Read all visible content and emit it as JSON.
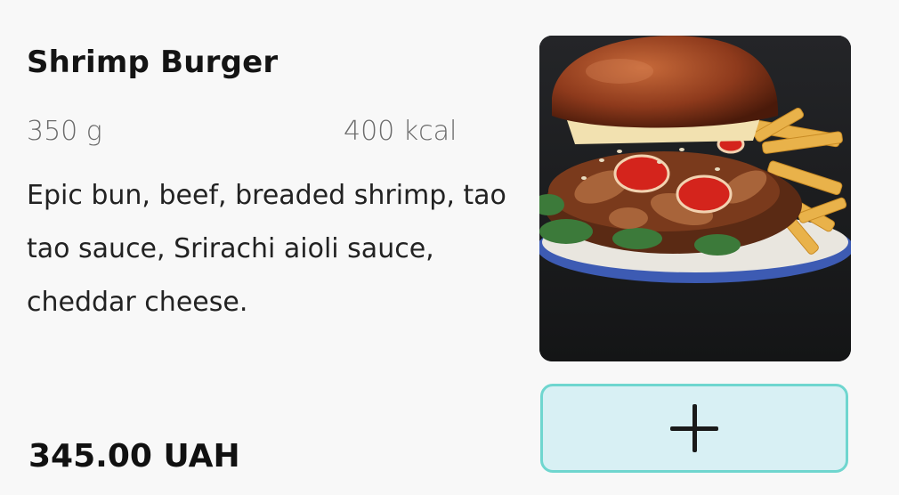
{
  "product": {
    "name": "Shrimp Burger",
    "weight": "350 g",
    "calories": "400 kcal",
    "description": "Epic bun, beef, breaded shrimp, tao tao sauce, Srirachi aioli sauce, cheddar cheese.",
    "price": "345.00 UAH"
  },
  "image": {
    "icon": "burger-photo",
    "background_color": "#1b1c1e",
    "plate_rim_color": "#3d5bb3"
  },
  "add_button": {
    "icon": "plus-icon",
    "border_color": "#6fd6cf",
    "background_color": "#d8f0f4"
  }
}
